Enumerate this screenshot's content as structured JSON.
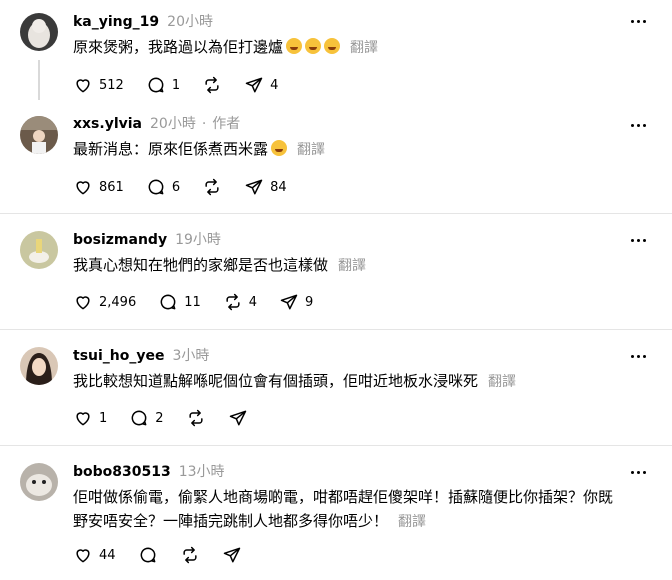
{
  "posts": [
    {
      "username": "ka_ying_19",
      "time": "20小時",
      "author_tag": "",
      "text": "原來煲粥，我路過以為佢打邊爐",
      "emojis": [
        "rolling-laughing",
        "rolling-laughing",
        "rolling-laughing"
      ],
      "translate": "翻譯",
      "likes": "512",
      "replies": "1",
      "reposts": "",
      "shares": "4"
    },
    {
      "username": "xxs.ylvia",
      "time": "20小時",
      "author_tag": "作者",
      "text": "最新消息：原來佢係煮西米露",
      "emojis": [
        "laughing"
      ],
      "translate": "翻譯",
      "likes": "861",
      "replies": "6",
      "reposts": "",
      "shares": "84"
    },
    {
      "username": "bosizmandy",
      "time": "19小時",
      "author_tag": "",
      "text": "我真心想知在牠們的家鄉是否也這樣做",
      "emojis": [],
      "translate": "翻譯",
      "likes": "2,496",
      "replies": "11",
      "reposts": "4",
      "shares": "9"
    },
    {
      "username": "tsui_ho_yee",
      "time": "3小時",
      "author_tag": "",
      "text": "我比較想知道點解喺呢個位會有個插頭，佢咁近地板水浸咪死",
      "emojis": [],
      "translate": "翻譯",
      "likes": "1",
      "replies": "2",
      "reposts": "",
      "shares": ""
    },
    {
      "username": "bobo830513",
      "time": "13小時",
      "author_tag": "",
      "text_line1": "佢咁做係偷電，偷緊人地商場啲電，咁都唔趕佢傻架咩！插蘇隨便比你插架？你既",
      "text_line2": "野安唔安全？一陣插完跳制人地都多得你唔少！",
      "emojis": [],
      "translate": "翻譯",
      "likes": "44",
      "replies": "",
      "reposts": "",
      "shares": ""
    }
  ],
  "colors": {
    "muted": "#999999",
    "divider": "#e5e5e5",
    "thread": "#d9d9d9"
  }
}
